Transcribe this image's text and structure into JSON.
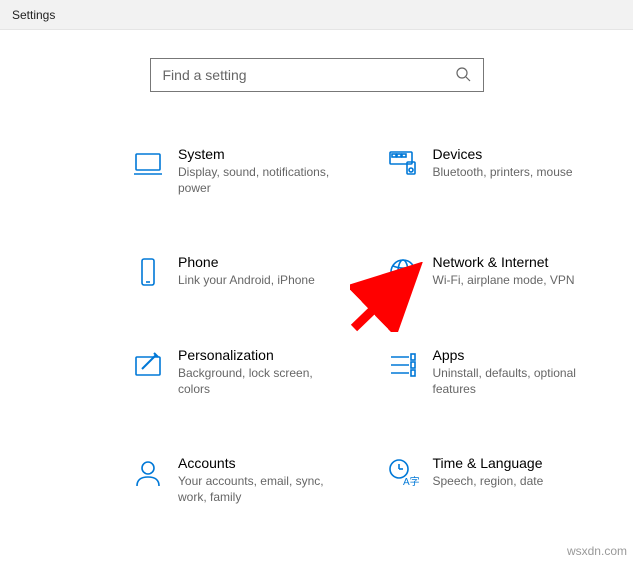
{
  "window": {
    "title": "Settings"
  },
  "search": {
    "placeholder": "Find a setting"
  },
  "categories": [
    {
      "id": "system",
      "title": "System",
      "desc": "Display, sound, notifications, power"
    },
    {
      "id": "devices",
      "title": "Devices",
      "desc": "Bluetooth, printers, mouse"
    },
    {
      "id": "phone",
      "title": "Phone",
      "desc": "Link your Android, iPhone"
    },
    {
      "id": "network",
      "title": "Network & Internet",
      "desc": "Wi-Fi, airplane mode, VPN"
    },
    {
      "id": "personalization",
      "title": "Personalization",
      "desc": "Background, lock screen, colors"
    },
    {
      "id": "apps",
      "title": "Apps",
      "desc": "Uninstall, defaults, optional features"
    },
    {
      "id": "accounts",
      "title": "Accounts",
      "desc": "Your accounts, email, sync, work, family"
    },
    {
      "id": "time-language",
      "title": "Time & Language",
      "desc": "Speech, region, date"
    }
  ],
  "annotation": {
    "arrow_target": "network"
  },
  "watermark": "wsxdn.com",
  "colors": {
    "accent": "#0078D7",
    "arrow": "#FF0000"
  }
}
